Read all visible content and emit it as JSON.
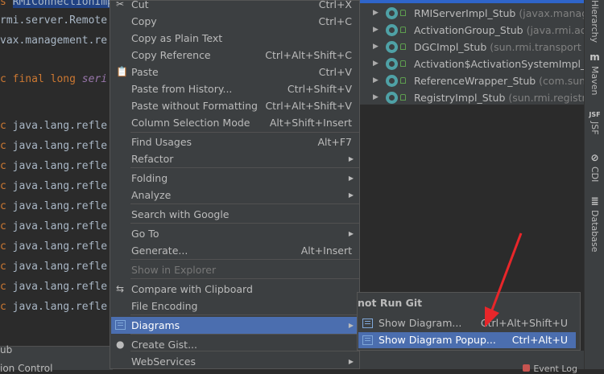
{
  "editor": {
    "lines": [
      {
        "pre": "s ",
        "text": "RMIConnectionImp",
        "kind": "selected"
      },
      {
        "pre": "",
        "text": "rmi.server.Remote",
        "kind": "plain"
      },
      {
        "pre": "",
        "text": "vax.management.re",
        "kind": "plain"
      },
      {
        "pre": "c ",
        "text": "final long seri",
        "kind": "decl"
      },
      {
        "pre": "c ",
        "text": "java.lang.refle",
        "kind": "field"
      },
      {
        "pre": "c ",
        "text": "java.lang.refle",
        "kind": "field"
      },
      {
        "pre": "c ",
        "text": "java.lang.refle",
        "kind": "field"
      },
      {
        "pre": "c ",
        "text": "java.lang.refle",
        "kind": "field"
      },
      {
        "pre": "c ",
        "text": "java.lang.refle",
        "kind": "field"
      },
      {
        "pre": "c ",
        "text": "java.lang.refle",
        "kind": "field"
      },
      {
        "pre": "c ",
        "text": "java.lang.refle",
        "kind": "field"
      },
      {
        "pre": "c ",
        "text": "java.lang.refle",
        "kind": "field"
      },
      {
        "pre": "c ",
        "text": "java.lang.refle",
        "kind": "field"
      },
      {
        "pre": "c ",
        "text": "java.lang.refle",
        "kind": "field"
      }
    ],
    "bottom_text_1": "ub",
    "bottom_text_2": "ion Control"
  },
  "context_menu": {
    "items": [
      {
        "label": "Cut",
        "shortcut": "Ctrl+X",
        "icon": "scissors-icon",
        "glyph": "✂"
      },
      {
        "label": "Copy",
        "shortcut": "Ctrl+C"
      },
      {
        "label": "Copy as Plain Text",
        "shortcut": ""
      },
      {
        "label": "Copy Reference",
        "shortcut": "Ctrl+Alt+Shift+C"
      },
      {
        "label": "Paste",
        "shortcut": "Ctrl+V",
        "icon": "clipboard-icon",
        "glyph": "📋"
      },
      {
        "label": "Paste from History...",
        "shortcut": "Ctrl+Shift+V"
      },
      {
        "label": "Paste without Formatting",
        "shortcut": "Ctrl+Alt+Shift+V"
      },
      {
        "label": "Column Selection Mode",
        "shortcut": "Alt+Shift+Insert"
      },
      {
        "label": "Find Usages",
        "shortcut": "Alt+F7"
      },
      {
        "label": "Refactor",
        "submenu": true
      },
      {
        "label": "Folding",
        "submenu": true
      },
      {
        "label": "Analyze",
        "submenu": true
      },
      {
        "label": "Search with Google",
        "shortcut": ""
      },
      {
        "label": "Go To",
        "submenu": true
      },
      {
        "label": "Generate...",
        "shortcut": "Alt+Insert"
      },
      {
        "label": "Show in Explorer",
        "disabled": true
      },
      {
        "label": "Compare with Clipboard",
        "icon": "compare-icon",
        "glyph": "⇆"
      },
      {
        "label": "File Encoding",
        "shortcut": ""
      },
      {
        "label": "Diagrams",
        "submenu": true,
        "active": true,
        "icon": "diagram-icon"
      },
      {
        "label": "Create Gist...",
        "icon": "github-icon",
        "glyph": "●"
      },
      {
        "label": "WebServices",
        "submenu": true
      }
    ]
  },
  "submenu": {
    "header": "not Run Git",
    "items": [
      {
        "label": "Show Diagram...",
        "shortcut": "Ctrl+Alt+Shift+U"
      },
      {
        "label": "Show Diagram Popup...",
        "shortcut": "Ctrl+Alt+U",
        "active": true
      }
    ]
  },
  "hierarchy": {
    "rows": [
      {
        "name": "RMIServerImpl_Stub",
        "pkg": "(javax.managen"
      },
      {
        "name": "ActivationGroup_Stub",
        "pkg": "(java.rmi.activa"
      },
      {
        "name": "DGCImpl_Stub",
        "pkg": "(sun.rmi.transport"
      },
      {
        "name": "Activation$ActivationSystemImpl_Stul",
        "pkg": ""
      },
      {
        "name": "ReferenceWrapper_Stub",
        "pkg": "(com.sun.jn"
      },
      {
        "name": "RegistryImpl_Stub",
        "pkg": "(sun.rmi.registry"
      }
    ]
  },
  "sidebar": {
    "tabs": [
      {
        "label": "Hierarchy",
        "icon": ""
      },
      {
        "label": "Maven",
        "icon": "m"
      },
      {
        "label": "JSF",
        "icon": "JSF"
      },
      {
        "label": "CDI",
        "icon": "⊘"
      },
      {
        "label": "Database",
        "icon": "≣"
      }
    ]
  },
  "status": {
    "event_log": "Event Log"
  },
  "colors": {
    "arrow": "#e8262a",
    "accent": "#4b6eaf"
  }
}
